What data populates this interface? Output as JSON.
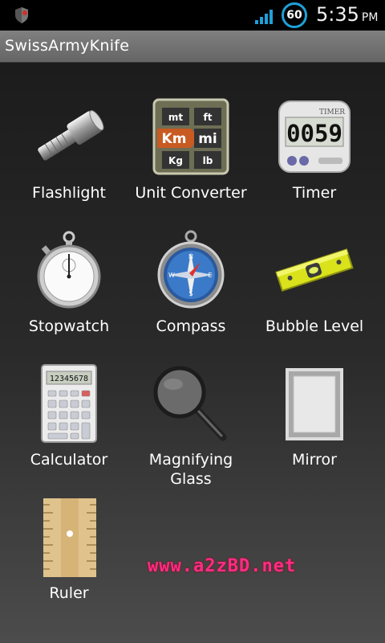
{
  "status_bar": {
    "battery_level": "60",
    "time": "5:35",
    "ampm": "PM",
    "icons": [
      "shield-icon",
      "signal-icon",
      "battery-icon"
    ]
  },
  "app": {
    "title": "SwissArmyKnife"
  },
  "tools": [
    {
      "label": "Flashlight",
      "icon": "flashlight-icon"
    },
    {
      "label": "Unit Converter",
      "icon": "unit-converter-icon",
      "units": [
        "mt",
        "ft",
        "Km",
        "mi",
        "Kg",
        "lb"
      ]
    },
    {
      "label": "Timer",
      "icon": "timer-icon",
      "brand": "TIMER",
      "display": "0059"
    },
    {
      "label": "Stopwatch",
      "icon": "stopwatch-icon"
    },
    {
      "label": "Compass",
      "icon": "compass-icon",
      "directions": [
        "N",
        "E",
        "S",
        "W"
      ]
    },
    {
      "label": "Bubble Level",
      "icon": "bubble-level-icon"
    },
    {
      "label": "Calculator",
      "icon": "calculator-icon",
      "display": "12345678"
    },
    {
      "label": "Magnifying\nGlass",
      "icon": "magnifying-glass-icon"
    },
    {
      "label": "Mirror",
      "icon": "mirror-icon"
    },
    {
      "label": "Ruler",
      "icon": "ruler-icon"
    }
  ],
  "watermark": "www.a2zBD.net",
  "colors": {
    "accent_blue": "#1fa0d8",
    "title_bar": "#737373",
    "watermark": "#ff2b8a",
    "level_yellow": "#d9e21a"
  }
}
